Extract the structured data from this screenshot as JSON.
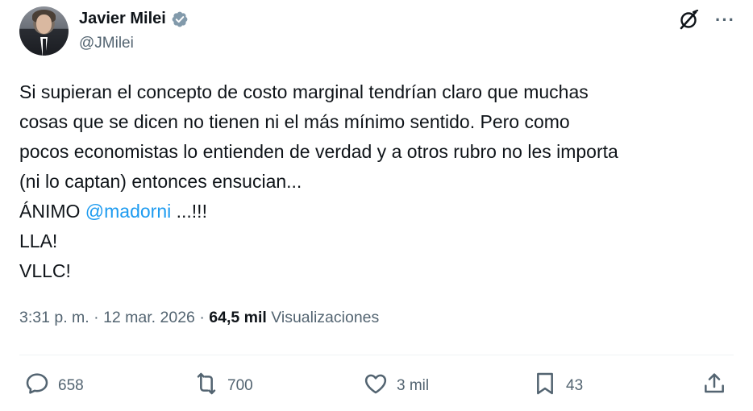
{
  "author": {
    "name": "Javier Milei",
    "handle": "@JMilei",
    "verified_color": "#829aab"
  },
  "header_icons": {
    "grok": "grok-icon",
    "more": "···"
  },
  "tweet": {
    "lines": [
      "Si supieran el concepto de costo marginal tendrían claro que muchas",
      "cosas que se dicen no tienen ni el más mínimo sentido. Pero como",
      "pocos economistas lo entienden de verdad y a otros rubro no les importa",
      "(ni lo captan) entonces ensucian..."
    ],
    "animo_prefix": "ÁNIMO ",
    "mention": "@madorni",
    "animo_suffix": " ...!!!",
    "line_lla": "LLA!",
    "line_vllc": "VLLC!"
  },
  "meta": {
    "time": "3:31 p. m.",
    "sep1": " · ",
    "date": "12 mar. 2026",
    "sep2": " · ",
    "views_count": "64,5 mil",
    "views_label": " Visualizaciones"
  },
  "actions": {
    "replies": "658",
    "reposts": "700",
    "likes": "3 mil",
    "bookmarks": "43"
  },
  "colors": {
    "text": "#0f1419",
    "secondary": "#536471",
    "link": "#1d9bf0",
    "divider": "#eff3f4"
  }
}
